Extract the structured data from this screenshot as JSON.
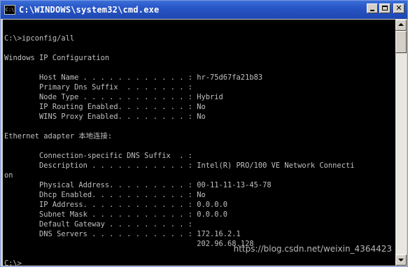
{
  "window": {
    "title": "C:\\WINDOWS\\system32\\cmd.exe",
    "icon_text": "C:\\",
    "icons": [
      "cmd-icon",
      "minimize-icon",
      "maximize-icon",
      "close-icon"
    ],
    "close_glyph": "✕"
  },
  "console": {
    "text_color": "#c0c0c0",
    "background": "#000000",
    "lines": [
      "",
      "C:\\>ipconfig/all",
      "",
      "Windows IP Configuration",
      "",
      "        Host Name . . . . . . . . . . . . : hr-75d67fa21b83",
      "        Primary Dns Suffix  . . . . . . . :",
      "        Node Type . . . . . . . . . . . . : Hybrid",
      "        IP Routing Enabled. . . . . . . . : No",
      "        WINS Proxy Enabled. . . . . . . . : No",
      "",
      "Ethernet adapter 本地连接:",
      "",
      "        Connection-specific DNS Suffix  . :",
      "        Description . . . . . . . . . . . : Intel(R) PRO/100 VE Network Connecti",
      "on",
      "        Physical Address. . . . . . . . . : 00-11-11-13-45-78",
      "        Dhcp Enabled. . . . . . . . . . . : No",
      "        IP Address. . . . . . . . . . . . : 0.0.0.0",
      "        Subnet Mask . . . . . . . . . . . : 0.0.0.0",
      "        Default Gateway . . . . . . . . . :",
      "        DNS Servers . . . . . . . . . . . : 172.16.2.1",
      "                                            202.96.68.128",
      "",
      "C:\\>"
    ]
  },
  "watermark": "https://blog.csdn.net/weixin_4364423"
}
